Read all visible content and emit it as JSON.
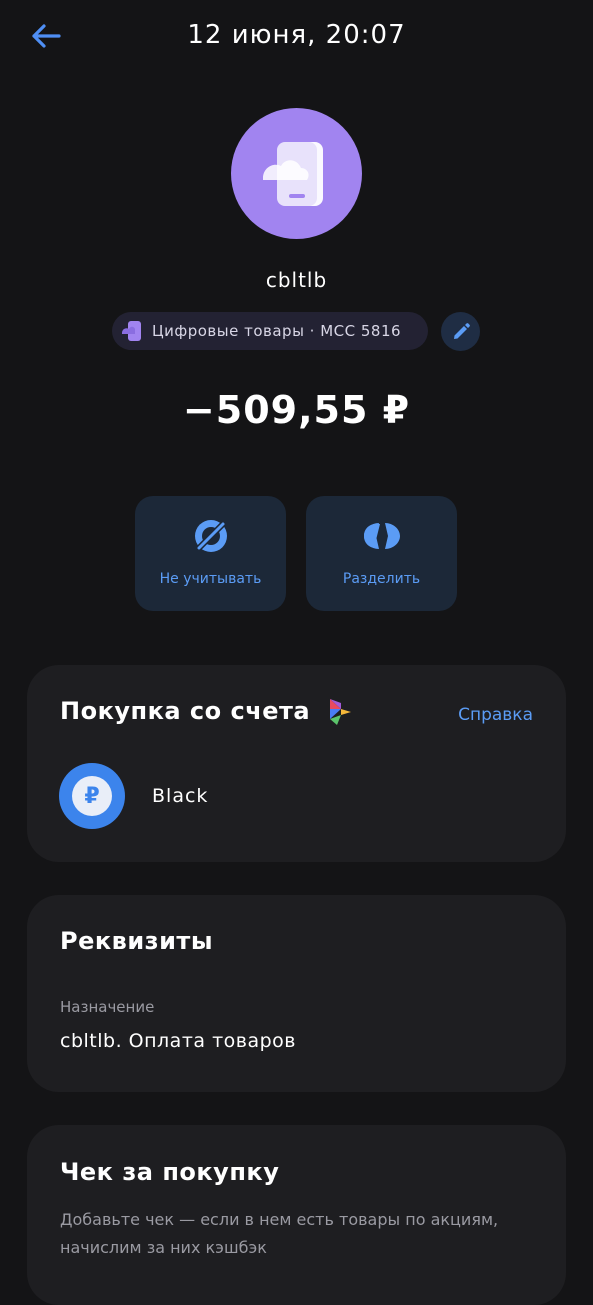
{
  "header": {
    "title": "12 июня, 20:07"
  },
  "merchant": {
    "name": "cbltlb",
    "category": "Цифровые товары · MCC 5816",
    "amount": "−509,55 ₽",
    "logo_color": "#a184f0"
  },
  "actions": [
    {
      "label": "Не учитывать",
      "icon": "eye-off-icon"
    },
    {
      "label": "Разделить",
      "icon": "split-icon"
    }
  ],
  "purchase_card": {
    "title": "Покупка со счета",
    "help_label": "Справка",
    "account_name": "Black",
    "account_icon": "ruble-icon"
  },
  "details_card": {
    "title": "Реквизиты",
    "purpose_label": "Назначение",
    "purpose_value": "cbltlb. Оплата товаров"
  },
  "receipt_card": {
    "title": "Чек за покупку",
    "description": "Добавьте чек — если в нем есть товары по акциям, начислим за них кэшбэк"
  },
  "colors": {
    "background": "#141416",
    "card": "#1e1e21",
    "accent": "#5b9cf5",
    "action_bg": "#1c2838"
  }
}
